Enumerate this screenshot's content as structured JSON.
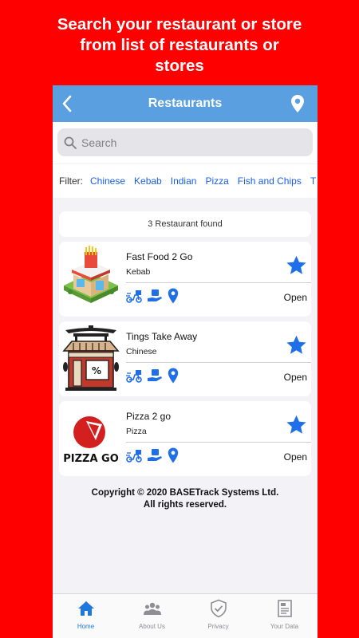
{
  "promo": {
    "line1": "Search your restaurant or store",
    "line2": "from list of restaurants or",
    "line3": "stores"
  },
  "navbar": {
    "title": "Restaurants",
    "back_icon": "chevron-left-icon",
    "location_icon": "location-pin-icon"
  },
  "search": {
    "placeholder": "Search",
    "value": ""
  },
  "filter": {
    "label": "Filter:",
    "options": [
      "Chinese",
      "Kebab",
      "Indian",
      "Pizza",
      "Fish and Chips",
      "T"
    ]
  },
  "found_text": "3 Restaurant found",
  "restaurants": [
    {
      "name": "Fast Food 2 Go",
      "cuisine": "Kebab",
      "status": "Open",
      "logo": "fast-food-shop-logo"
    },
    {
      "name": "Tings Take Away",
      "cuisine": "Chinese",
      "status": "Open",
      "logo": "chinese-shop-logo"
    },
    {
      "name": "Pizza 2 go",
      "cuisine": "Pizza",
      "status": "Open",
      "logo": "pizza-go-logo",
      "logo_text": "PIZZA GO"
    }
  ],
  "copyright": "Copyright © 2020 BASETrack Systems Ltd. All rights reserved.",
  "tabs": [
    {
      "label": "Home",
      "icon": "home-icon",
      "active": true
    },
    {
      "label": "About Us",
      "icon": "people-icon",
      "active": false
    },
    {
      "label": "Privacy",
      "icon": "shield-icon",
      "active": false
    },
    {
      "label": "Your Data",
      "icon": "data-file-icon",
      "active": false
    }
  ],
  "colors": {
    "background": "#ff0000",
    "navbar": "#5a9fe0",
    "accent": "#1f6fe8",
    "tab_active": "#1f78e0"
  }
}
